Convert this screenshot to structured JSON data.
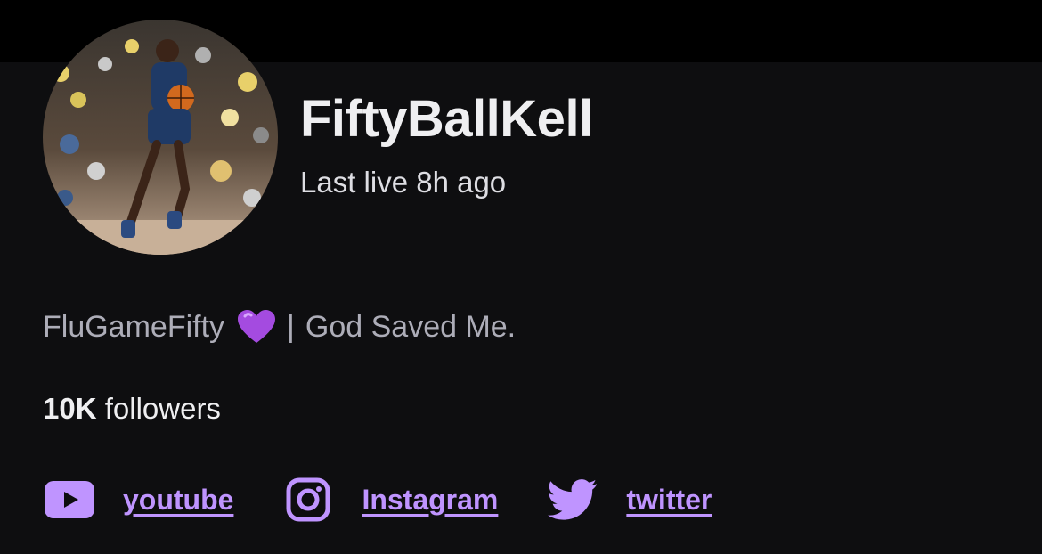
{
  "channel": {
    "name": "FiftyBallKell",
    "last_live": "Last live 8h ago"
  },
  "bio": {
    "left": "FluGameFifty",
    "heart_icon": "purple-heart-emoji",
    "separator": "|",
    "right": "God Saved Me."
  },
  "followers": {
    "count": "10K",
    "label": " followers"
  },
  "social_links": [
    {
      "icon": "youtube-icon",
      "label": "youtube"
    },
    {
      "icon": "instagram-icon",
      "label": "Instagram"
    },
    {
      "icon": "twitter-icon",
      "label": "twitter"
    }
  ],
  "colors": {
    "background": "#0e0e10",
    "top_bar": "#000000",
    "accent": "#bf94ff",
    "text_primary": "#efeff1",
    "text_secondary": "#adadb8"
  }
}
